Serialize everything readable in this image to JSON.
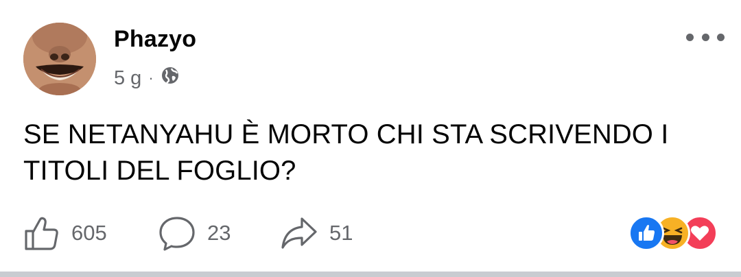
{
  "post": {
    "author": "Phazyo",
    "time": "5 g",
    "separator": "·",
    "visibility_icon": "globe-icon",
    "text": "SE NETANYAHU È MORTO CHI STA SCRIVENDO I TITOLI DEL FOGLIO?"
  },
  "actions": {
    "likes": "605",
    "comments": "23",
    "shares": "51"
  },
  "reactions": [
    "like-reaction-icon",
    "haha-reaction-icon",
    "love-reaction-icon"
  ],
  "colors": {
    "text": "#050505",
    "secondary": "#65676b",
    "like_blue": "#1877f2",
    "haha_yellow": "#f7b125",
    "love_red": "#f33e58"
  }
}
